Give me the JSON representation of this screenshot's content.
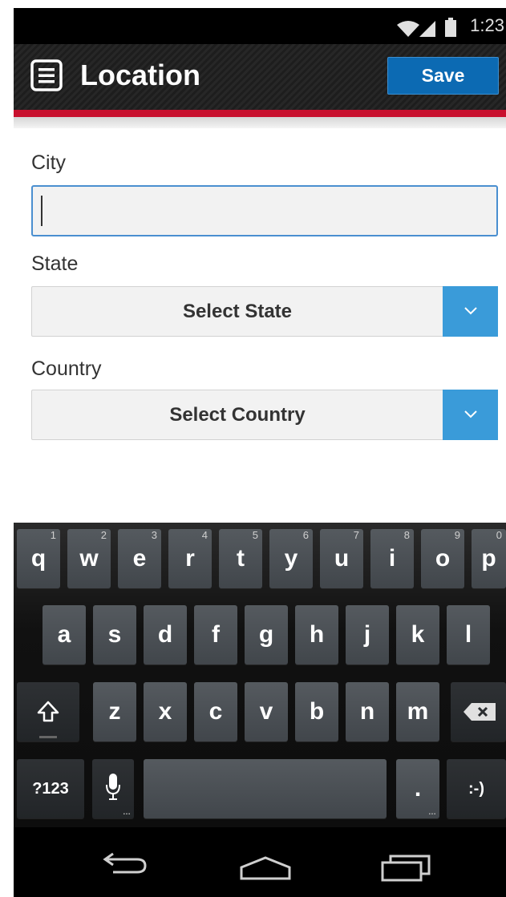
{
  "status_bar": {
    "time": "1:23",
    "icons": [
      "wifi-icon",
      "signal-icon",
      "battery-icon"
    ]
  },
  "action_bar": {
    "title": "Location",
    "menu_icon": "menu-icon",
    "save_label": "Save"
  },
  "form": {
    "city": {
      "label": "City",
      "value": "",
      "placeholder": ""
    },
    "state": {
      "label": "State",
      "selected": "Select State"
    },
    "country": {
      "label": "Country",
      "selected": "Select Country"
    }
  },
  "keyboard": {
    "row1": [
      {
        "key": "q",
        "hint": "1"
      },
      {
        "key": "w",
        "hint": "2"
      },
      {
        "key": "e",
        "hint": "3"
      },
      {
        "key": "r",
        "hint": "4"
      },
      {
        "key": "t",
        "hint": "5"
      },
      {
        "key": "y",
        "hint": "6"
      },
      {
        "key": "u",
        "hint": "7"
      },
      {
        "key": "i",
        "hint": "8"
      },
      {
        "key": "o",
        "hint": "9"
      },
      {
        "key": "p",
        "hint": "0"
      }
    ],
    "row2": [
      "a",
      "s",
      "d",
      "f",
      "g",
      "h",
      "j",
      "k",
      "l"
    ],
    "row3": [
      "z",
      "x",
      "c",
      "v",
      "b",
      "n",
      "m"
    ],
    "symbols_label": "?123",
    "period_label": ".",
    "smiley_label": ":-)"
  },
  "colors": {
    "accent_red": "#c8102e",
    "save_blue": "#0c6ab3",
    "select_arrow_blue": "#3a9bd9"
  },
  "nav_bar": {
    "icons": [
      "back-icon",
      "home-icon",
      "recent-apps-icon"
    ]
  }
}
